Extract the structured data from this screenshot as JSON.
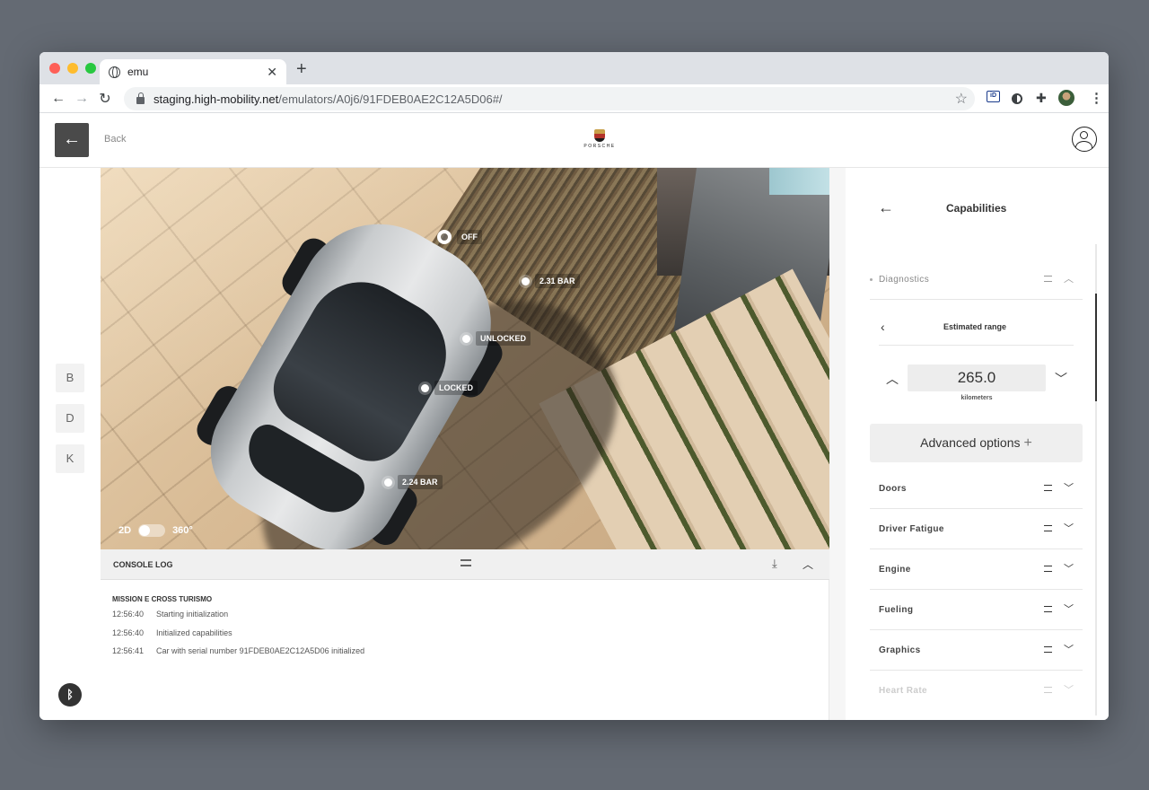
{
  "browser": {
    "tab_title": "emu",
    "new_tab": "+",
    "tab_close": "✕",
    "url_host": "staging.high-mobility.net",
    "url_path": "/emulators/A0j6/91FDEB0AE2C12A5D06#/",
    "ext_id_label": "iD"
  },
  "header": {
    "back_label": "Back",
    "brand_wordmark": "PORSCHE"
  },
  "rail": {
    "keys": [
      "B",
      "D",
      "K"
    ],
    "bluetooth_glyph": "ᛒ"
  },
  "scene": {
    "hotspots": {
      "roof": "OFF",
      "tire_front_right": "2.31 BAR",
      "door_front": "UNLOCKED",
      "door_rear": "LOCKED",
      "tire_rear_left": "2.24 BAR"
    },
    "toggle_left": "2D",
    "toggle_right": "360°"
  },
  "console": {
    "title": "CONSOLE LOG",
    "vehicle": "MISSION E CROSS TURISMO",
    "entries": [
      {
        "time": "12:56:40",
        "message": "Starting initialization"
      },
      {
        "time": "12:56:40",
        "message": "Initialized capabilities"
      },
      {
        "time": "12:56:41",
        "message": "Car with serial number 91FDEB0AE2C12A5D06 initialized"
      }
    ]
  },
  "panel": {
    "title": "Capabilities",
    "diagnostics_label": "Diagnostics",
    "property_title": "Estimated range",
    "value": "265.0",
    "unit": "kilometers",
    "advanced_label": "Advanced options",
    "capabilities": [
      "Doors",
      "Driver Fatigue",
      "Engine",
      "Fueling",
      "Graphics",
      "Heart Rate"
    ]
  },
  "colors": {
    "header_button": "#4a4a4a",
    "panel_button": "#efefef",
    "page_backdrop": "#646a73"
  }
}
